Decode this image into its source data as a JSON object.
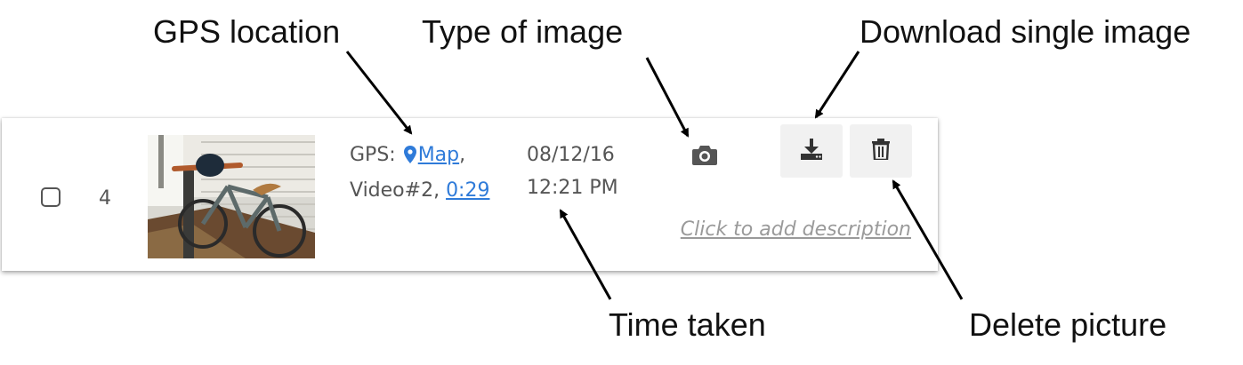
{
  "annotations": {
    "gps_location": "GPS location",
    "type_of_image": "Type of image",
    "download_single": "Download single image",
    "time_taken": "Time taken",
    "delete_picture": "Delete picture"
  },
  "row": {
    "index": "4",
    "gps_prefix": "GPS:",
    "map_link": "Map",
    "gps_suffix": ",",
    "video_label": "Video#2,",
    "time_link": "0:29",
    "date": "08/12/16",
    "time": "12:21 PM",
    "description_placeholder": "Click to add description",
    "media_type_icon": "camera-icon",
    "download_icon": "download-icon",
    "delete_icon": "trash-icon",
    "checked": false
  },
  "colors": {
    "link": "#2f7bd9",
    "text": "#555555",
    "button_bg": "#f1f1f1",
    "placeholder": "#9a9a9a"
  }
}
